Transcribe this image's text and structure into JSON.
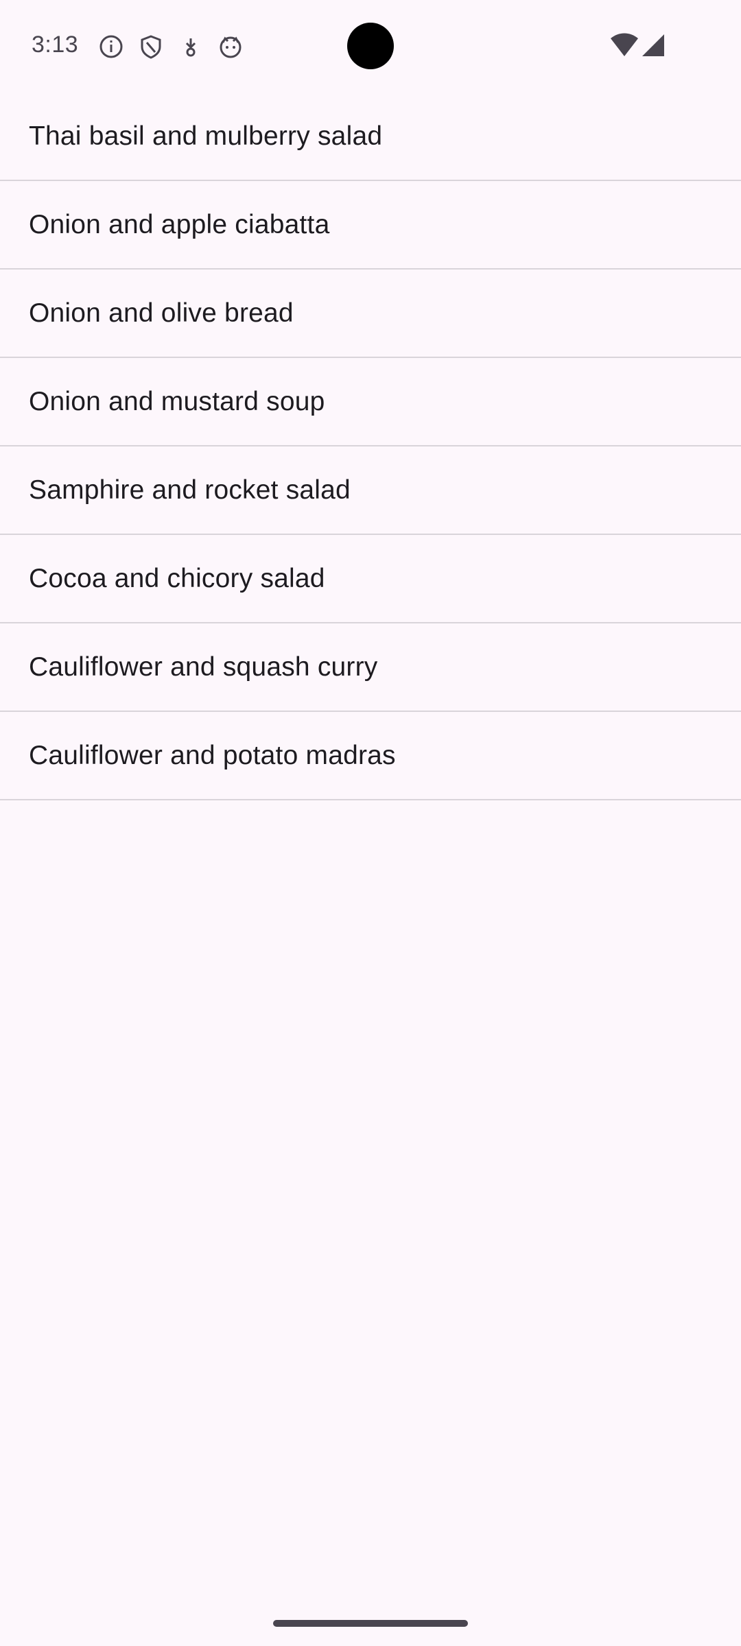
{
  "status_bar": {
    "time": "3:13",
    "icons": [
      "info-icon",
      "shield-icon",
      "download-arrow-icon",
      "cat-face-icon",
      "wifi-icon",
      "cell-signal-icon"
    ]
  },
  "recipes": [
    {
      "label": "Thai basil and mulberry salad"
    },
    {
      "label": "Onion and apple ciabatta"
    },
    {
      "label": "Onion and olive bread"
    },
    {
      "label": "Onion and mustard soup"
    },
    {
      "label": "Samphire and rocket salad"
    },
    {
      "label": "Cocoa and chicory salad"
    },
    {
      "label": "Cauliflower and squash curry"
    },
    {
      "label": "Cauliflower and potato madras"
    }
  ],
  "colors": {
    "background": "#fdf7fc",
    "text": "#1d1b20",
    "divider": "#d9d4da",
    "status_text": "#49454f"
  }
}
